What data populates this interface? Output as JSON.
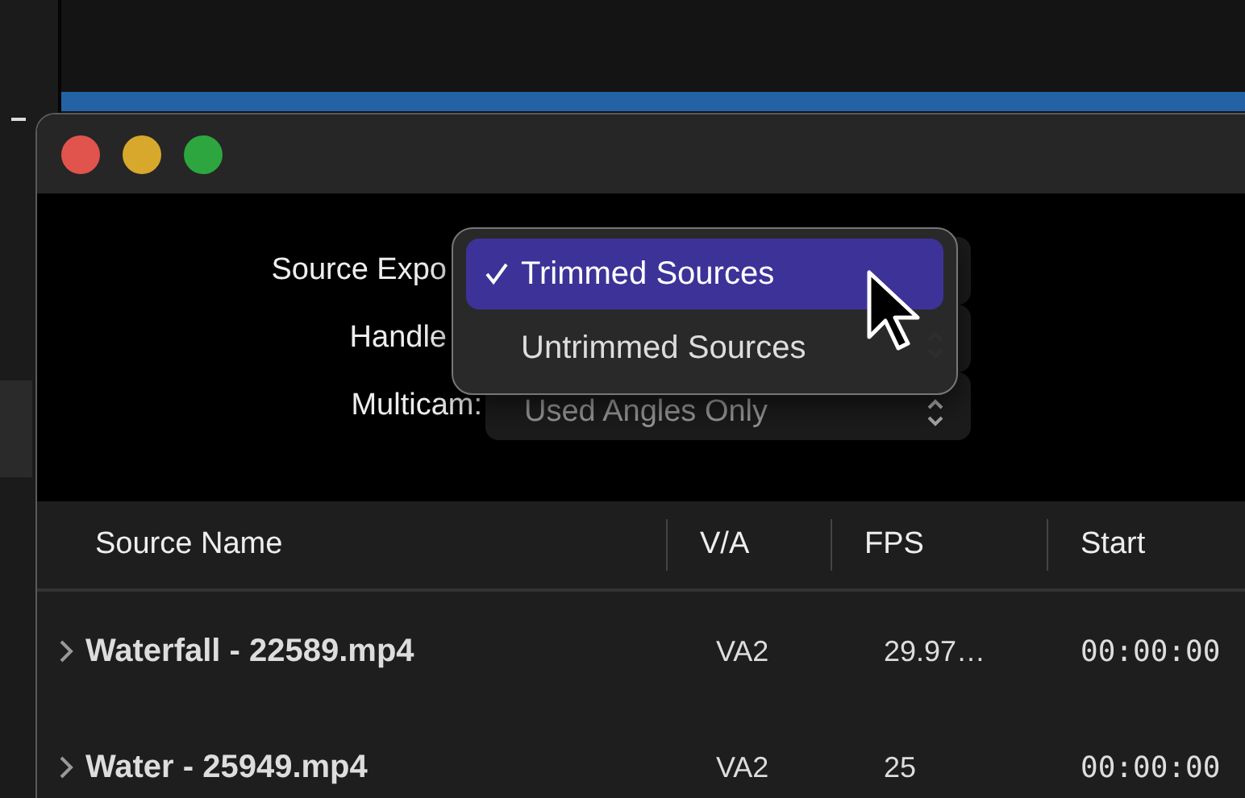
{
  "form": {
    "rows": [
      {
        "label": "Source Expo"
      },
      {
        "label": "Handle"
      },
      {
        "label": "Multicam:",
        "value": "Used Angles Only"
      }
    ]
  },
  "popup": {
    "options": [
      {
        "label": "Trimmed Sources",
        "selected": true
      },
      {
        "label": "Untrimmed Sources",
        "selected": false
      }
    ]
  },
  "table": {
    "columns": [
      "Source Name",
      "V/A",
      "FPS",
      "Start"
    ],
    "rows": [
      {
        "name": "Waterfall - 22589.mp4",
        "va": "VA2",
        "fps": "29.97…",
        "start": "00:00:00",
        "expanded": false
      },
      {
        "name": "Water - 25949.mp4",
        "va": "VA2",
        "fps": "25",
        "start": "00:00:00",
        "expanded": false
      }
    ]
  }
}
